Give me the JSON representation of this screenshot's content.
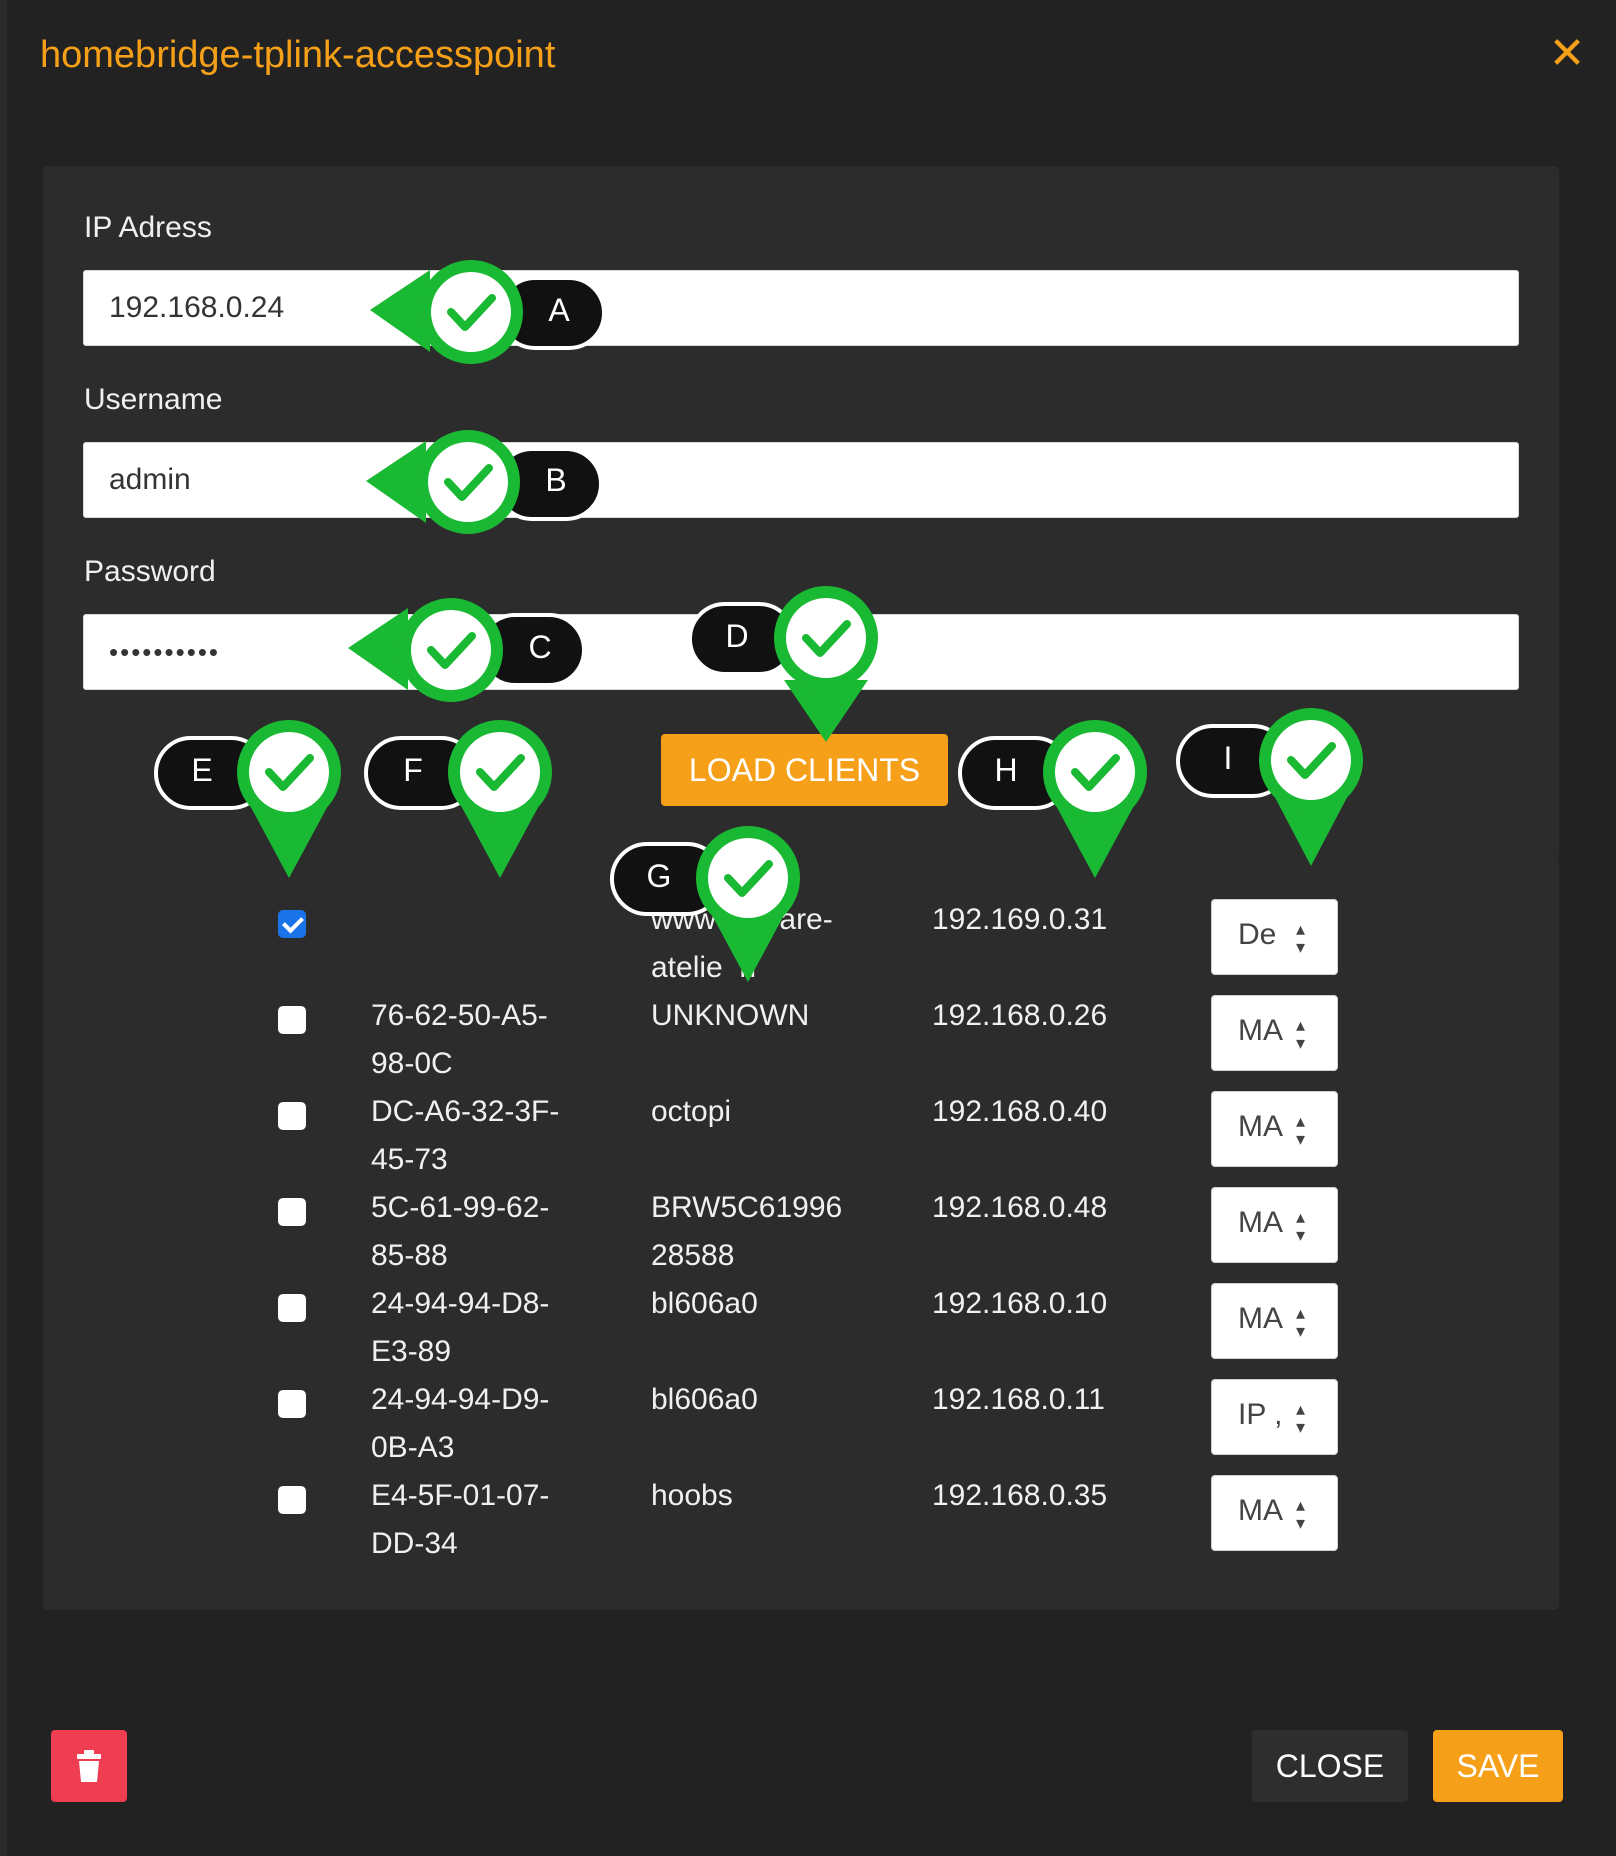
{
  "modal": {
    "title": "homebridge-tplink-accesspoint",
    "close_icon": "close-icon"
  },
  "form": {
    "ip_label": "IP Adress",
    "ip_value": "192.168.0.24",
    "username_label": "Username",
    "username_value": "admin",
    "password_label": "Password",
    "password_value": "••••••••••",
    "load_clients_label": "LOAD CLIENTS"
  },
  "clients": [
    {
      "checked": true,
      "mac1": "",
      "mac2": "",
      "name1": "www",
      "name2": "ware-",
      "name3": "atelie",
      "name4": "n",
      "ip": "192.169.0.31",
      "select": "De"
    },
    {
      "checked": false,
      "mac1": "76-62-50-A5-",
      "mac2": "98-0C",
      "name1": "UNKNOWN",
      "name2": "",
      "ip": "192.168.0.26",
      "select": "MA"
    },
    {
      "checked": false,
      "mac1": "DC-A6-32-3F-",
      "mac2": "45-73",
      "name1": "octopi",
      "name2": "",
      "ip": "192.168.0.40",
      "select": "MA"
    },
    {
      "checked": false,
      "mac1": "5C-61-99-62-",
      "mac2": "85-88",
      "name1": "BRW5C61996",
      "name2": "28588",
      "ip": "192.168.0.48",
      "select": "MA"
    },
    {
      "checked": false,
      "mac1": "24-94-94-D8-",
      "mac2": "E3-89",
      "name1": "bl606a0",
      "name2": "",
      "ip": "192.168.0.10",
      "select": "MA"
    },
    {
      "checked": false,
      "mac1": "24-94-94-D9-",
      "mac2": "0B-A3",
      "name1": "bl606a0",
      "name2": "",
      "ip": "192.168.0.11",
      "select": "IP ,"
    },
    {
      "checked": false,
      "mac1": "E4-5F-01-07-",
      "mac2": "DD-34",
      "name1": "hoobs",
      "name2": "",
      "ip": "192.168.0.35",
      "select": "MA"
    }
  ],
  "footer": {
    "delete_icon": "trash-icon",
    "close_label": "CLOSE",
    "save_label": "SAVE"
  },
  "markers": [
    "A",
    "B",
    "C",
    "D",
    "E",
    "F",
    "G",
    "H",
    "I"
  ],
  "colors": {
    "accent": "#f6a01a",
    "danger": "#ef3e51",
    "marker_green": "#1ab934",
    "checkbox_blue": "#1a73e8"
  }
}
